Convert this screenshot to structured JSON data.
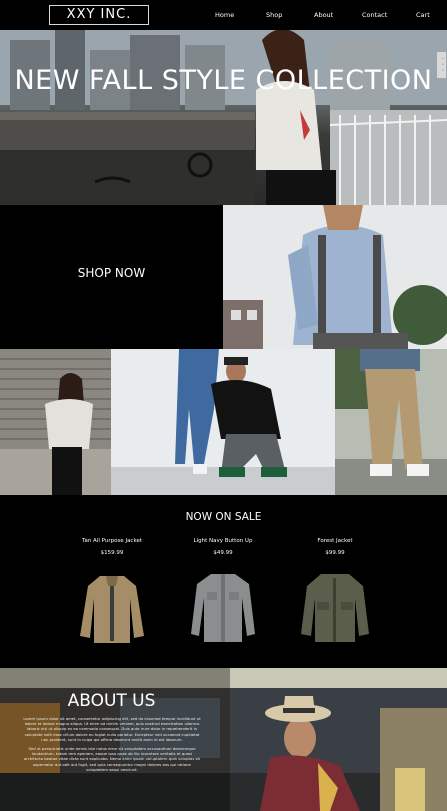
{
  "nav": {
    "logo": "XXY INC.",
    "links": [
      "Home",
      "Shop",
      "About",
      "Contact",
      "Cart"
    ]
  },
  "hero": {
    "title": "NEW FALL STYLE COLLECTION"
  },
  "shop": {
    "button_label": "SHOP NOW"
  },
  "sale": {
    "title": "NOW ON SALE",
    "products": [
      {
        "name": "Tan All Purpose Jacket",
        "price": "$159.99",
        "icon": "tan-jacket-image"
      },
      {
        "name": "Light Navy Button Up",
        "price": "$49.99",
        "icon": "gray-shirt-image"
      },
      {
        "name": "Forest Jacket",
        "price": "$99.99",
        "icon": "green-jacket-image"
      }
    ]
  },
  "about": {
    "title": "ABOUT US",
    "paragraph1": "Lorem ipsum dolor sit amet, consectetur adipiscing elit, sed do eiusmod tempor incididunt ut labore et dolore magna aliqua. Ut enim ad minim veniam, quis nostrud exercitation ullamco laboris nisi ut aliquip ex ea commodo consequat. Duis aute irure dolor in reprehenderit in voluptate velit esse cillum dolore eu fugiat nulla pariatur. Excepteur sint occaecat cupidatat non proident, sunt in culpa qui officia deserunt mollit anim id est laborum.",
    "paragraph2": "Sed ut perspiciatis unde omnis iste natus error sit voluptatem accusantium doloremque laudantium, totam rem aperiam, eaque ipsa quae ab illo inventore veritatis et quasi architecto beatae vitae dicta sunt explicabo. Nemo enim ipsam voluptatem quia voluptas sit aspernatur aut odit aut fugit, sed quia consequuntur magni dolores eos qui ratione voluptatem sequi nesciunt."
  }
}
